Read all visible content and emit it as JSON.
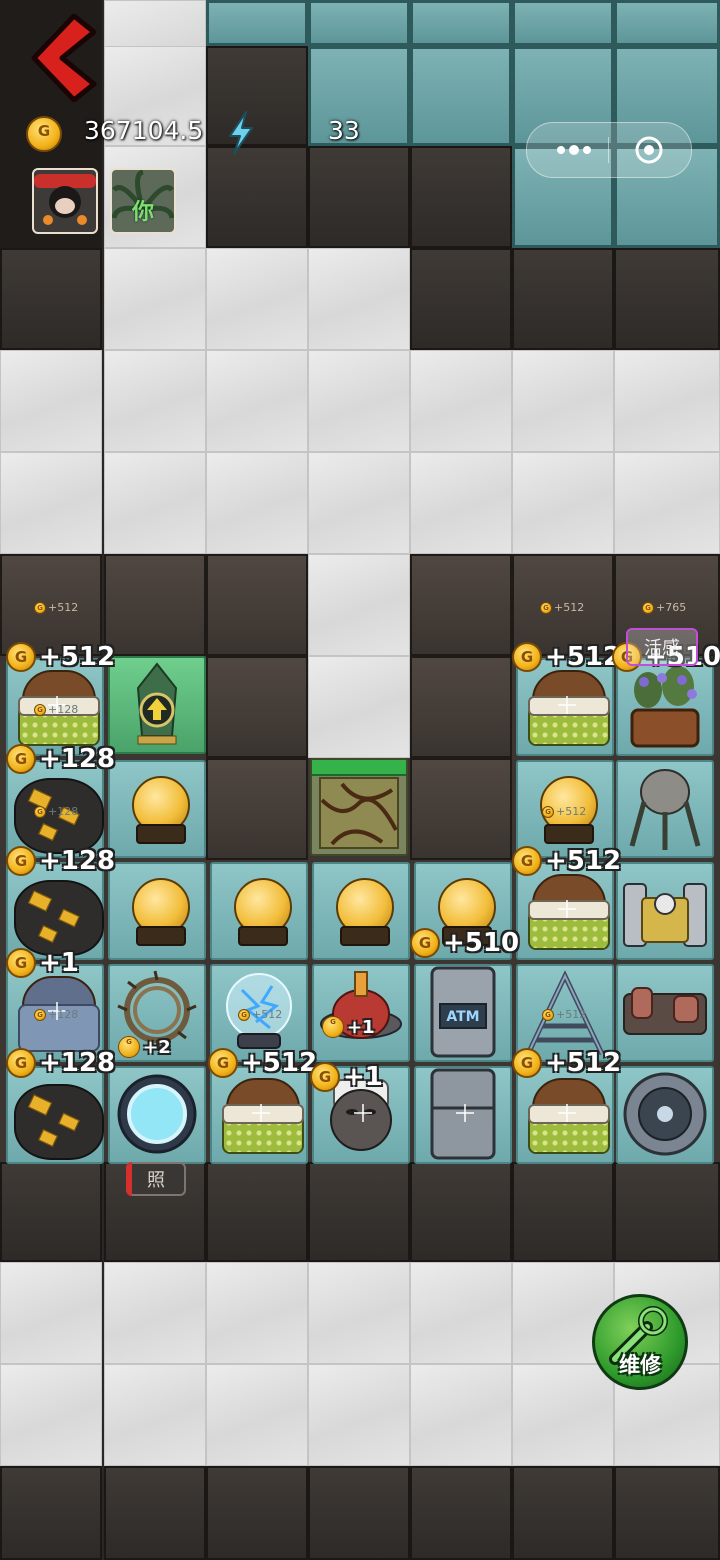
{
  "hud": {
    "coins": "367104.5",
    "energy": "33"
  },
  "buttons": {
    "photo": "照",
    "repair": "维修",
    "tag": "活感"
  },
  "avatars": [
    {
      "name": "player-avatar",
      "badge": ""
    },
    {
      "name": "plant-avatar",
      "badge": "你"
    }
  ],
  "bonuses": {
    "b1": "+512",
    "b2": "+128",
    "b3": "+128",
    "b4": "+1",
    "b5": "+128",
    "b6": "+512",
    "b7": "+510",
    "b8": "+512",
    "b9": "+510",
    "b10": "+512",
    "b11": "+1",
    "b12": "+1",
    "b13": "+512",
    "b14": "+2"
  },
  "tiny_bonuses": {
    "t1": "+512",
    "t2": "+512",
    "t3": "+765",
    "t4": "+128",
    "t5": "+128",
    "t6": "+512",
    "t7": "+512",
    "t8": "+128",
    "t9": "+512"
  },
  "colors": {
    "accent_red": "#d6302c",
    "repair_green": "#2f9b2c",
    "cell_teal": "#7eb7b9",
    "coin_gold": "#f1b219"
  }
}
